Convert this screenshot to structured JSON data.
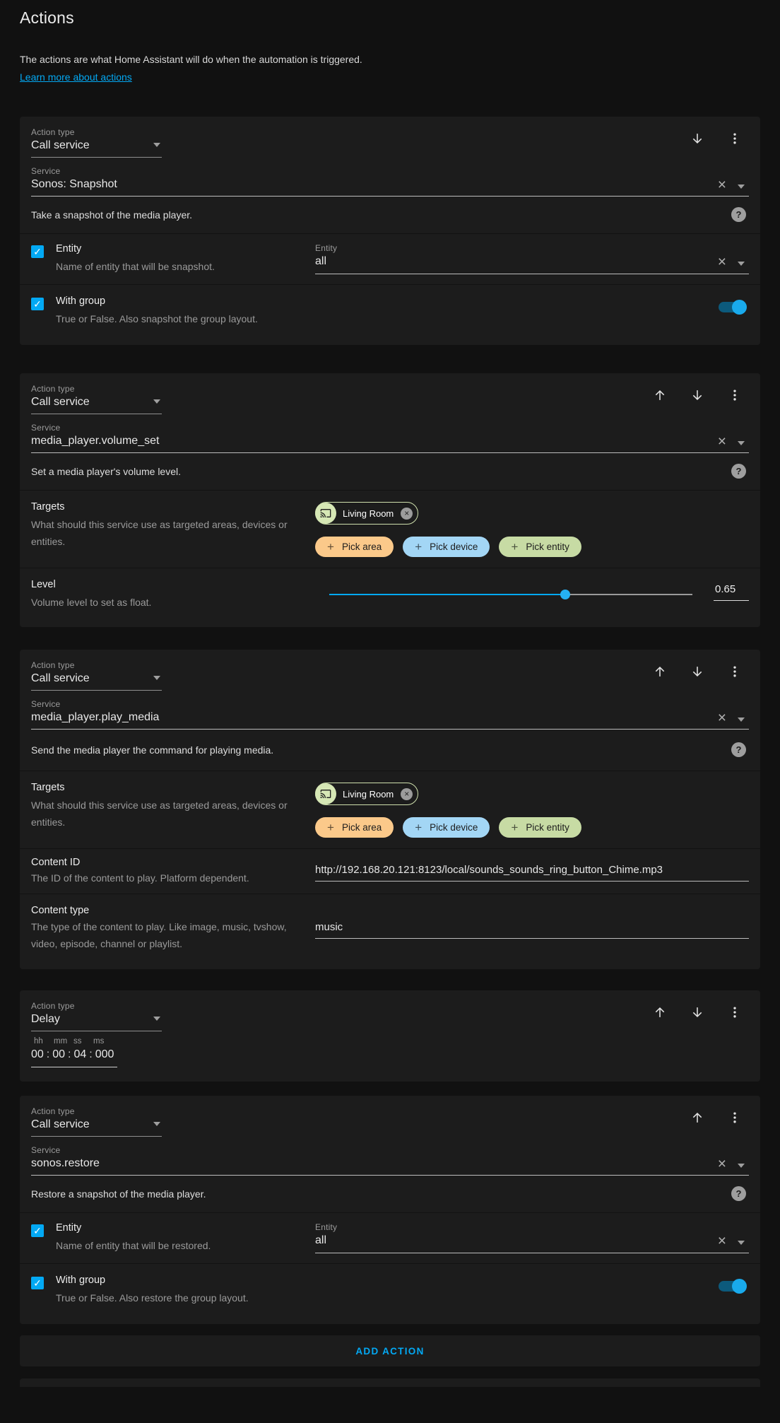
{
  "page": {
    "title": "Actions",
    "intro": "The actions are what Home Assistant will do when the automation is triggered.",
    "learn_more_link": "Learn more about actions"
  },
  "field_labels": {
    "action_type": "Action type",
    "service": "Service"
  },
  "colors": {
    "accent": "#03a9f4",
    "page_bg": "#111111",
    "card_bg": "#1c1c1c",
    "help_bg": "#9e9e9e",
    "pick_area": "#fbc98a",
    "pick_device": "#a3d6f5",
    "pick_entity": "#c7dba4",
    "chip_icon_bg": "#d6e7b5"
  },
  "icons": {
    "clear": "×",
    "check": "✓",
    "help": "?",
    "plus": "+",
    "chip_remove": "×"
  },
  "cards": [
    {
      "action_type": "Call service",
      "service": "Sonos: Snapshot",
      "service_description": "Take a snapshot of the media player.",
      "entity": {
        "label": "Entity",
        "description": "Name of entity that will be snapshot.",
        "field_label": "Entity",
        "value": "all",
        "checked": true
      },
      "with_group": {
        "label": "With group",
        "description": "True or False. Also snapshot the group layout.",
        "checked": true,
        "enabled": true
      }
    },
    {
      "action_type": "Call service",
      "service": "media_player.volume_set",
      "service_description": "Set a media player's volume level.",
      "targets": {
        "label": "Targets",
        "description": "What should this service use as targeted areas, devices or entities.",
        "chips": [
          {
            "name": "Living Room"
          }
        ],
        "buttons": {
          "pick_area": "Pick area",
          "pick_device": "Pick device",
          "pick_entity": "Pick entity"
        }
      },
      "level": {
        "label": "Level",
        "description": "Volume level to set as float.",
        "value": "0.65",
        "percent": 65
      }
    },
    {
      "action_type": "Call service",
      "service": "media_player.play_media",
      "service_description": "Send the media player the command for playing media.",
      "targets": {
        "label": "Targets",
        "description": "What should this service use as targeted areas, devices or entities.",
        "chips": [
          {
            "name": "Living Room"
          }
        ],
        "buttons": {
          "pick_area": "Pick area",
          "pick_device": "Pick device",
          "pick_entity": "Pick entity"
        }
      },
      "content_id": {
        "label": "Content ID",
        "description": "The ID of the content to play. Platform dependent.",
        "value": "http://192.168.20.121:8123/local/sounds_sounds_ring_button_Chime.mp3"
      },
      "content_type": {
        "label": "Content type",
        "description": "The type of the content to play. Like image, music, tvshow, video, episode, channel or playlist.",
        "value": "music"
      }
    },
    {
      "action_type": "Delay",
      "duration": {
        "unit_labels": [
          "hh",
          "mm",
          "ss",
          "ms"
        ],
        "parts": [
          "00",
          "00",
          "04",
          "000"
        ],
        "separator": ":"
      }
    },
    {
      "action_type": "Call service",
      "service": "sonos.restore",
      "service_description": "Restore a snapshot of the media player.",
      "entity": {
        "label": "Entity",
        "description": "Name of entity that will be restored.",
        "field_label": "Entity",
        "value": "all",
        "checked": true
      },
      "with_group": {
        "label": "With group",
        "description": "True or False. Also restore the group layout.",
        "checked": true,
        "enabled": true
      }
    }
  ],
  "footer": {
    "add_action": "ADD ACTION"
  }
}
